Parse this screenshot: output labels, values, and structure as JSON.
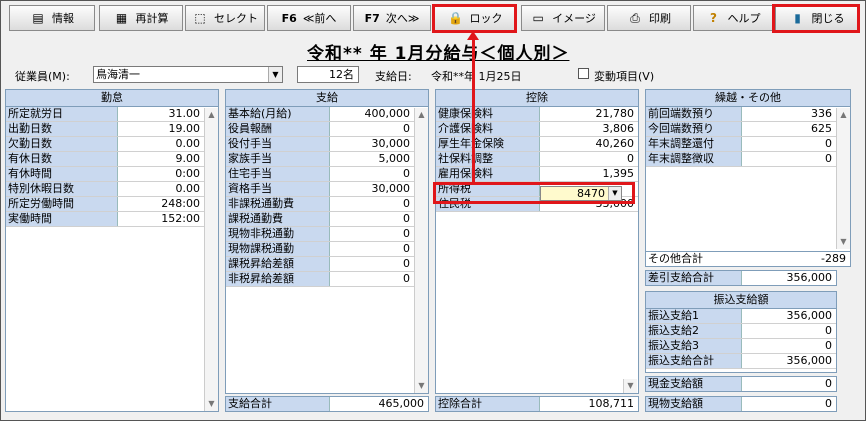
{
  "toolbar": {
    "info": "情報",
    "recalc": "再計算",
    "select": "セレクト",
    "prev_key": "F6",
    "prev": "≪前へ",
    "next_key": "F7",
    "next": "次へ≫",
    "lock": "ロック",
    "image": "イメージ",
    "print": "印刷",
    "help": "ヘルプ",
    "close": "閉じる"
  },
  "title": "令和** 年 1月分給与＜個人別＞",
  "employee": {
    "label": "従業員(M):",
    "name": "鳥海清一",
    "count": "12名",
    "payday_label": "支給日:",
    "payday": "令和**年 1月25日",
    "variable_label": "変動項目(V)"
  },
  "attendance": {
    "header": "勤怠",
    "rows": [
      {
        "label": "所定就労日",
        "value": "31.00"
      },
      {
        "label": "出勤日数",
        "value": "19.00"
      },
      {
        "label": "欠勤日数",
        "value": "0.00"
      },
      {
        "label": "有休日数",
        "value": "9.00"
      },
      {
        "label": "有休時間",
        "value": "0:00"
      },
      {
        "label": "特別休暇日数",
        "value": "0.00"
      },
      {
        "label": "所定労働時間",
        "value": "248:00"
      },
      {
        "label": "実働時間",
        "value": "152:00"
      }
    ]
  },
  "payment": {
    "header": "支給",
    "rows": [
      {
        "label": "基本給(月給)",
        "value": "400,000"
      },
      {
        "label": "役員報酬",
        "value": "0"
      },
      {
        "label": "役付手当",
        "value": "30,000"
      },
      {
        "label": "家族手当",
        "value": "5,000"
      },
      {
        "label": "住宅手当",
        "value": "0"
      },
      {
        "label": "資格手当",
        "value": "30,000"
      },
      {
        "label": "非課税通勤費",
        "value": "0"
      },
      {
        "label": "課税通勤費",
        "value": "0"
      },
      {
        "label": "現物非税通勤",
        "value": "0"
      },
      {
        "label": "現物課税通勤",
        "value": "0"
      },
      {
        "label": "課税昇給差額",
        "value": "0"
      },
      {
        "label": "非税昇給差額",
        "value": "0"
      }
    ],
    "total_label": "支給合計",
    "total": "465,000"
  },
  "deduction": {
    "header": "控除",
    "rows": [
      {
        "label": "健康保険料",
        "value": "21,780"
      },
      {
        "label": "介護保険料",
        "value": "3,806"
      },
      {
        "label": "厚生年金保険",
        "value": "40,260"
      },
      {
        "label": "社保料調整",
        "value": "0"
      },
      {
        "label": "雇用保険料",
        "value": "1,395"
      }
    ],
    "income_tax_label": "所得税",
    "income_tax_value": "8470",
    "resident_tax_label": "住民税",
    "resident_tax_value": "33,000",
    "total_label": "控除合計",
    "total": "108,711"
  },
  "carry": {
    "header": "繰越・その他",
    "rows": [
      {
        "label": "前回端数預り",
        "value": "336"
      },
      {
        "label": "今回端数預り",
        "value": "625"
      },
      {
        "label": "年末調整還付",
        "value": "0"
      },
      {
        "label": "年末調整徴収",
        "value": "0"
      }
    ],
    "other_total_label": "その他合計",
    "other_total": "-289",
    "net_label": "差引支給合計",
    "net": "356,000"
  },
  "transfer": {
    "header": "振込支給額",
    "rows": [
      {
        "label": "振込支給1",
        "value": "356,000"
      },
      {
        "label": "振込支給2",
        "value": "0"
      },
      {
        "label": "振込支給3",
        "value": "0"
      },
      {
        "label": "振込支給合計",
        "value": "356,000"
      }
    ],
    "cash_label": "現金支給額",
    "cash": "0",
    "goods_label": "現物支給額",
    "goods": "0"
  }
}
